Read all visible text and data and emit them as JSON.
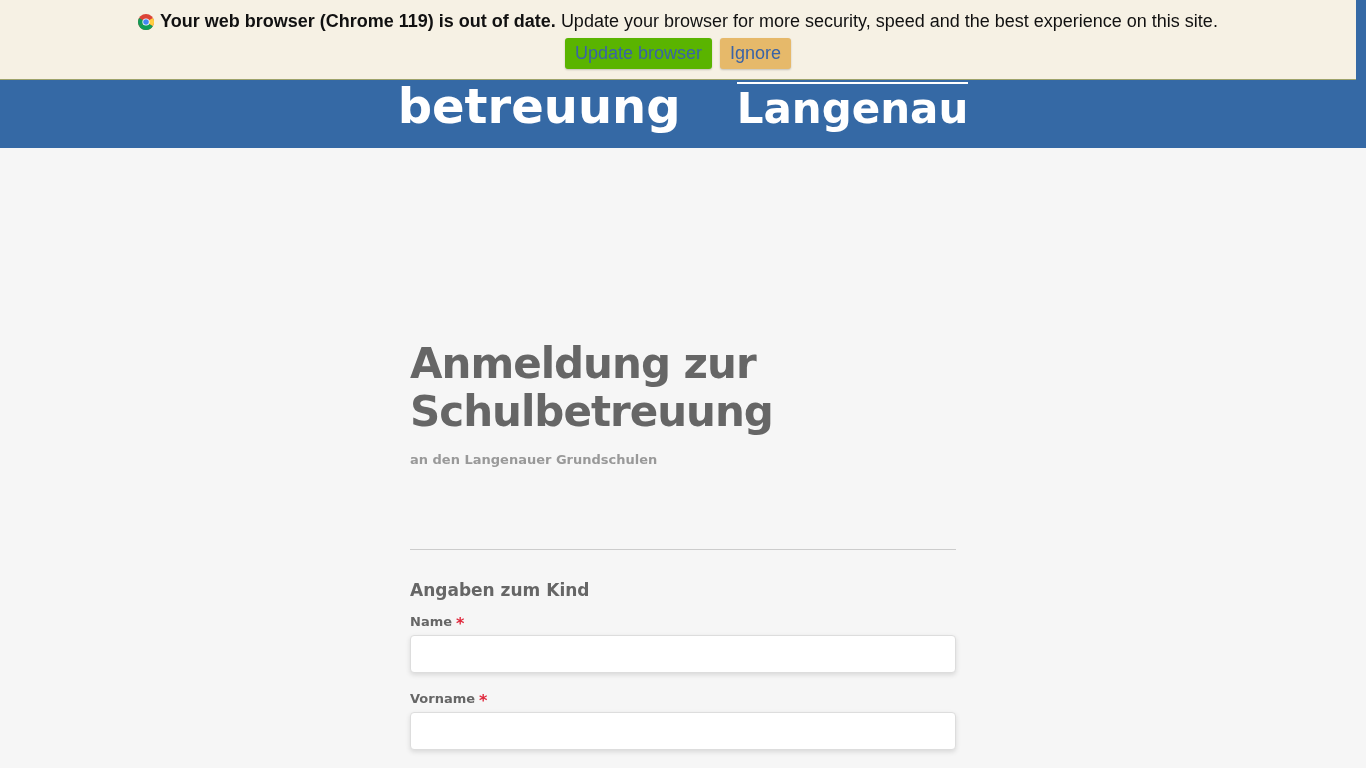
{
  "browser_notice": {
    "title": "Your web browser (Chrome 119) is out of date.",
    "message": "Update your browser for more security, speed and the best experience on this site.",
    "buttons": [
      {
        "kind": "primary",
        "label": "Update browser"
      },
      {
        "kind": "secondary",
        "label": "Ignore"
      }
    ]
  },
  "header": {
    "logo_text": "betreuung",
    "city_text": "Langenau"
  },
  "page": {
    "title": "Anmeldung zur Schulbetreuung",
    "subtitle": "an den Langenauer Grundschulen"
  },
  "form": {
    "section_title": "Angaben zum Kind",
    "fields": [
      {
        "label": "Name",
        "required": true,
        "required_mark": "*"
      },
      {
        "label": "Vorname",
        "required": true,
        "required_mark": "*"
      }
    ]
  }
}
